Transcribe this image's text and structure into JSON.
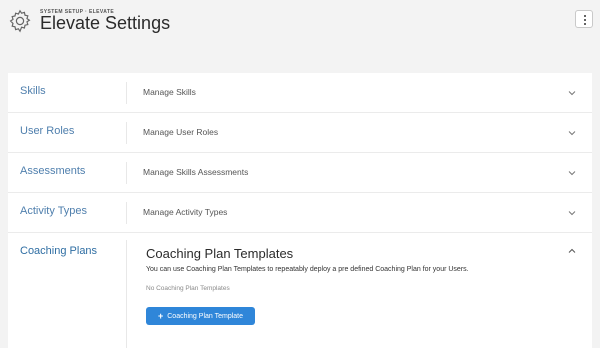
{
  "header": {
    "eyebrow": "SYSTEM SETUP · ELEVATE",
    "title": "Elevate Settings",
    "icon": "gear-icon",
    "menu_icon": "vertical-dots-icon"
  },
  "sections": [
    {
      "label": "Skills",
      "description": "Manage Skills",
      "expanded": false
    },
    {
      "label": "User Roles",
      "description": "Manage User Roles",
      "expanded": false
    },
    {
      "label": "Assessments",
      "description": "Manage Skills Assessments",
      "expanded": false
    },
    {
      "label": "Activity Types",
      "description": "Manage Activity Types",
      "expanded": false
    }
  ],
  "coaching": {
    "label": "Coaching Plans",
    "title": "Coaching Plan Templates",
    "description": "You can use Coaching Plan Templates to repeatably deploy a pre defined Coaching Plan for your Users.",
    "empty_text": "No Coaching Plan Templates",
    "button_label": "Coaching Plan Template",
    "button_icon": "plus-icon",
    "expanded": true
  },
  "colors": {
    "accent": "#2f86d9",
    "link": "#4f7fad",
    "background": "#f3f3f3"
  }
}
